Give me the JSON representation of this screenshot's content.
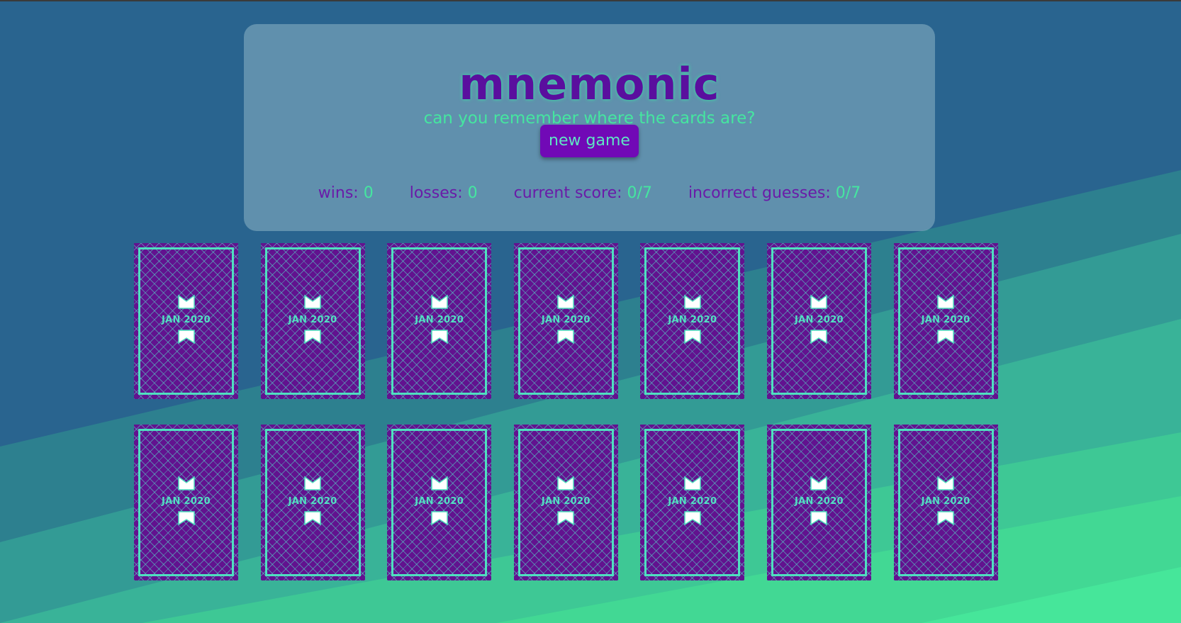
{
  "app": {
    "title": "mnemonic",
    "subtitle": "can you remember where the cards are?",
    "new_game_label": "new game"
  },
  "stats": [
    {
      "label": "wins:",
      "value": "0"
    },
    {
      "label": "losses:",
      "value": "0"
    },
    {
      "label": "current score:",
      "value": "0/7"
    },
    {
      "label": "incorrect guesses:",
      "value": "0/7"
    }
  ],
  "cards": [
    {
      "label": "JAN 2020"
    },
    {
      "label": "JAN 2020"
    },
    {
      "label": "JAN 2020"
    },
    {
      "label": "JAN 2020"
    },
    {
      "label": "JAN 2020"
    },
    {
      "label": "JAN 2020"
    },
    {
      "label": "JAN 2020"
    },
    {
      "label": "JAN 2020"
    },
    {
      "label": "JAN 2020"
    },
    {
      "label": "JAN 2020"
    },
    {
      "label": "JAN 2020"
    },
    {
      "label": "JAN 2020"
    },
    {
      "label": "JAN 2020"
    },
    {
      "label": "JAN 2020"
    }
  ],
  "icons": {
    "card_top": "crown-flag-icon",
    "card_bottom": "bookmark-flag-icon"
  },
  "colors": {
    "background": "#29648f",
    "accent_green": "#45e6a0",
    "title_purple": "#5a0f9e",
    "button_purple": "#7109b6",
    "card_purple": "#62128f",
    "card_border": "#4fe0bf"
  }
}
